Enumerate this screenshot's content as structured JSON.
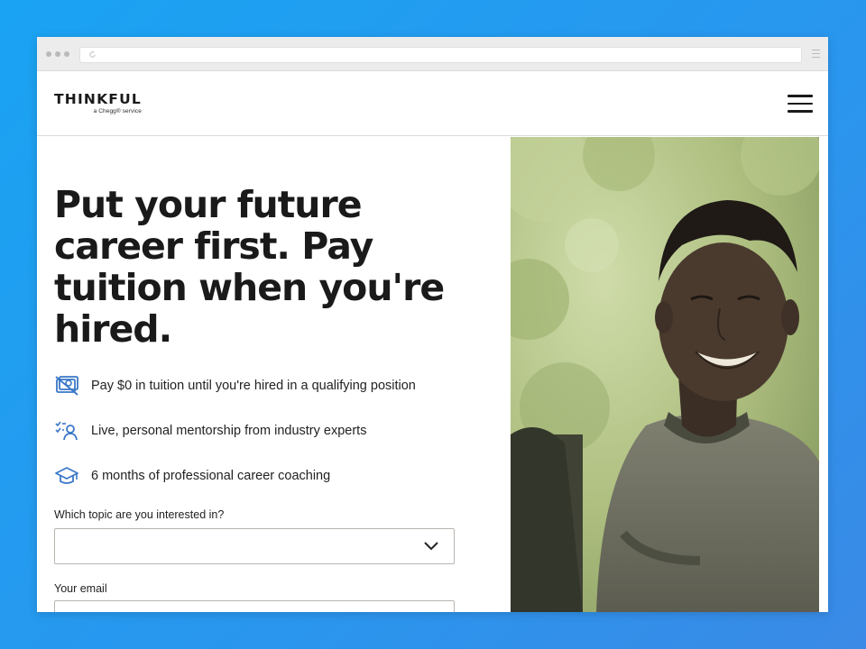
{
  "brand": {
    "name": "THINKFUL",
    "tagline": "a Chegg® service"
  },
  "hero": {
    "headline": "Put your future career first. Pay tuition when you're hired."
  },
  "features": [
    {
      "icon": "no-payment-icon",
      "text": "Pay $0 in tuition until you're hired in a qualifying position"
    },
    {
      "icon": "mentor-checklist-icon",
      "text": "Live, personal mentorship from industry experts"
    },
    {
      "icon": "graduation-cap-icon",
      "text": "6 months of professional career coaching"
    }
  ],
  "form": {
    "topic_label": "Which topic are you interested in?",
    "topic_value": "",
    "email_label": "Your email",
    "email_value": "",
    "email_placeholder": ""
  },
  "colors": {
    "background": "#1aa3f2",
    "icon_blue": "#3a78c8",
    "text_dark": "#1a1a1a",
    "photo_tint": "#b7c88c"
  }
}
